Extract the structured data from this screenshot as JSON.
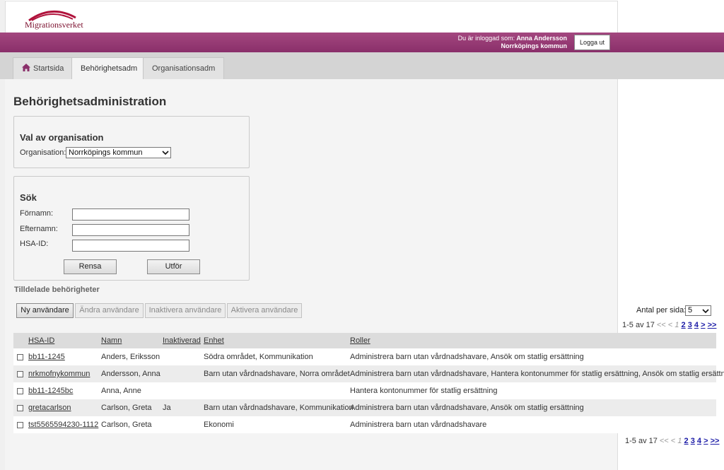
{
  "header": {
    "logo_text": "Migrationsverket",
    "login_label": "Du är inloggad som:",
    "user_name": "Anna Andersson",
    "user_org": "Norrköpings kommun",
    "logout_label": "Logga ut"
  },
  "tabs": [
    {
      "label": "Startsida",
      "icon": "home-icon"
    },
    {
      "label": "Behörighetsadm",
      "active": true
    },
    {
      "label": "Organisationsadm"
    }
  ],
  "page_title": "Behörighetsadministration",
  "org_panel": {
    "title": "Val av organisation",
    "label": "Organisation:",
    "selected": "Norrköpings kommun"
  },
  "search_panel": {
    "title": "Sök",
    "fields": [
      {
        "label": "Förnamn:",
        "value": ""
      },
      {
        "label": "Efternamn:",
        "value": ""
      },
      {
        "label": "HSA-ID:",
        "value": ""
      }
    ],
    "clear_label": "Rensa",
    "submit_label": "Utför"
  },
  "permissions": {
    "section_label": "Tilldelade behörigheter",
    "actions": [
      {
        "label": "Ny användare",
        "enabled": true
      },
      {
        "label": "Ändra användare",
        "enabled": false
      },
      {
        "label": "Inaktivera användare",
        "enabled": false
      },
      {
        "label": "Aktivera användare",
        "enabled": false
      }
    ],
    "per_page_label": "Antal per sida:",
    "per_page_value": "5",
    "pager": {
      "range": "1-5 av 17",
      "first": "<<",
      "prev": "<",
      "current": "1",
      "pages": [
        "2",
        "3",
        "4"
      ],
      "next": ">",
      "last": ">>"
    },
    "columns": [
      "HSA-ID",
      "Namn",
      "Inaktiverad",
      "Enhet",
      "Roller"
    ],
    "rows": [
      {
        "hsa_id": "bb11-1245",
        "name": "Anders, Eriksson",
        "inactive": "",
        "unit": "Södra området, Kommunikation",
        "roles": "Administrera barn utan vårdnadshavare, Ansök om statlig ersättning"
      },
      {
        "hsa_id": "nrkmofnykommun",
        "name": "Andersson, Anna",
        "inactive": "",
        "unit": "Barn utan vårdnadshavare, Norra området",
        "roles": "Administrera barn utan vårdnadshavare, Hantera kontonummer för statlig ersättning, Ansök om statlig ersättning"
      },
      {
        "hsa_id": "bb11-1245bc",
        "name": "Anna, Anne",
        "inactive": "",
        "unit": "",
        "roles": "Hantera kontonummer för statlig ersättning"
      },
      {
        "hsa_id": "gretacarlson",
        "name": "Carlson, Greta",
        "inactive": "Ja",
        "unit": "Barn utan vårdnadshavare, Kommunikation",
        "roles": "Administrera barn utan vårdnadshavare, Ansök om statlig ersättning"
      },
      {
        "hsa_id": "tst5565594230-1112",
        "name": "Carlson, Greta",
        "inactive": "",
        "unit": "Ekonomi",
        "roles": "Administrera barn utan vårdnadshavare"
      }
    ]
  },
  "colors": {
    "brand_purple": "#8a2f6a",
    "logo_red": "#b0123b",
    "link_blue": "#1a1aa6"
  }
}
